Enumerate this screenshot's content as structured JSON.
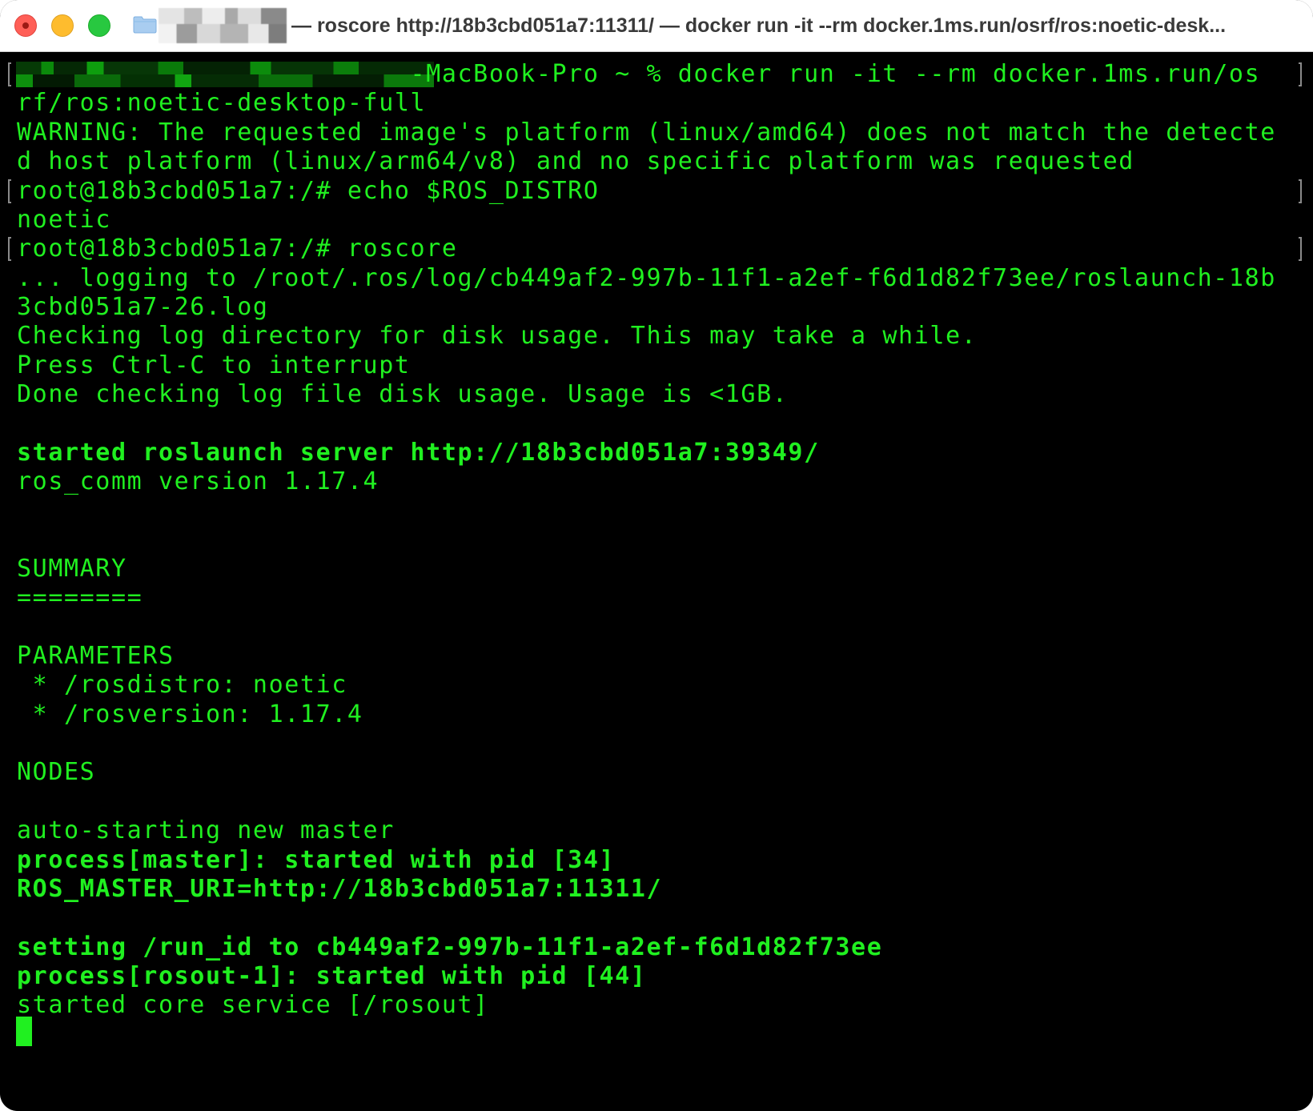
{
  "window": {
    "title": "— roscore http://18b3cbd051a7:11311/ — docker run -it --rm docker.1ms.run/osrf/ros:noetic-desk..."
  },
  "colors": {
    "terminal_bg": "#000000",
    "terminal_fg": "#20f020",
    "titlebar_bg": "#ffffff",
    "close": "#ff5f57",
    "minimize": "#febc2e",
    "zoom": "#28c840"
  },
  "icons": [
    "folder-icon"
  ],
  "terminal": {
    "lines": [
      "                         -MacBook-Pro ~ % docker run -it --rm docker.1ms.run/os",
      "rf/ros:noetic-desktop-full",
      "WARNING: The requested image's platform (linux/amd64) does not match the detecte",
      "d host platform (linux/arm64/v8) and no specific platform was requested",
      "root@18b3cbd051a7:/# echo $ROS_DISTRO",
      "noetic",
      "root@18b3cbd051a7:/# roscore",
      "... logging to /root/.ros/log/cb449af2-997b-11f1-a2ef-f6d1d82f73ee/roslaunch-18b",
      "3cbd051a7-26.log",
      "Checking log directory for disk usage. This may take a while.",
      "Press Ctrl-C to interrupt",
      "Done checking log file disk usage. Usage is <1GB.",
      "",
      "started roslaunch server http://18b3cbd051a7:39349/",
      "ros_comm version 1.17.4",
      "",
      "",
      "SUMMARY",
      "========",
      "",
      "PARAMETERS",
      " * /rosdistro: noetic",
      " * /rosversion: 1.17.4",
      "",
      "NODES",
      "",
      "auto-starting new master",
      "process[master]: started with pid [34]",
      "ROS_MASTER_URI=http://18b3cbd051a7:11311/",
      "",
      "setting /run_id to cb449af2-997b-11f1-a2ef-f6d1d82f73ee",
      "process[rosout-1]: started with pid [44]",
      "started core service [/rosout]"
    ]
  }
}
